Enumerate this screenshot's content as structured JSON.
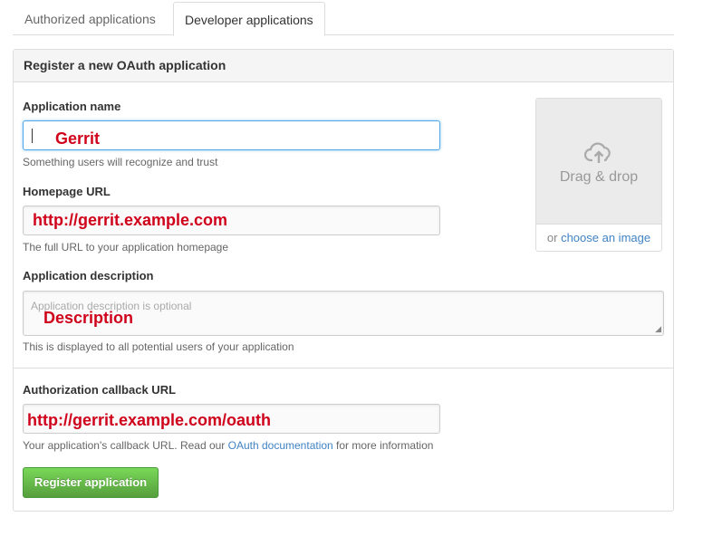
{
  "tabs": [
    {
      "label": "Authorized applications",
      "active": false
    },
    {
      "label": "Developer applications",
      "active": true
    }
  ],
  "panel": {
    "title": "Register a new OAuth application"
  },
  "form": {
    "app_name": {
      "label": "Application name",
      "value": "Gerrit",
      "hint": "Something users will recognize and trust"
    },
    "homepage": {
      "label": "Homepage URL",
      "value": "http://gerrit.example.com",
      "hint": "The full URL to your application homepage"
    },
    "description": {
      "label": "Application description",
      "placeholder": "Application description is optional",
      "value": "Description",
      "hint": "This is displayed to all potential users of your application"
    },
    "callback": {
      "label": "Authorization callback URL",
      "value": "http://gerrit.example.com/oauth",
      "hint_pre": "Your application's callback URL. Read our ",
      "hint_link": "OAuth documentation",
      "hint_post": " for more information"
    }
  },
  "dropzone": {
    "text": "Drag & drop",
    "or": "or ",
    "link": "choose an image",
    "icon": "cloud-upload-icon"
  },
  "submit": {
    "label": "Register application"
  },
  "colors": {
    "accent": "#4183c4",
    "annotation": "#d0021b",
    "button": "#6cc644"
  }
}
